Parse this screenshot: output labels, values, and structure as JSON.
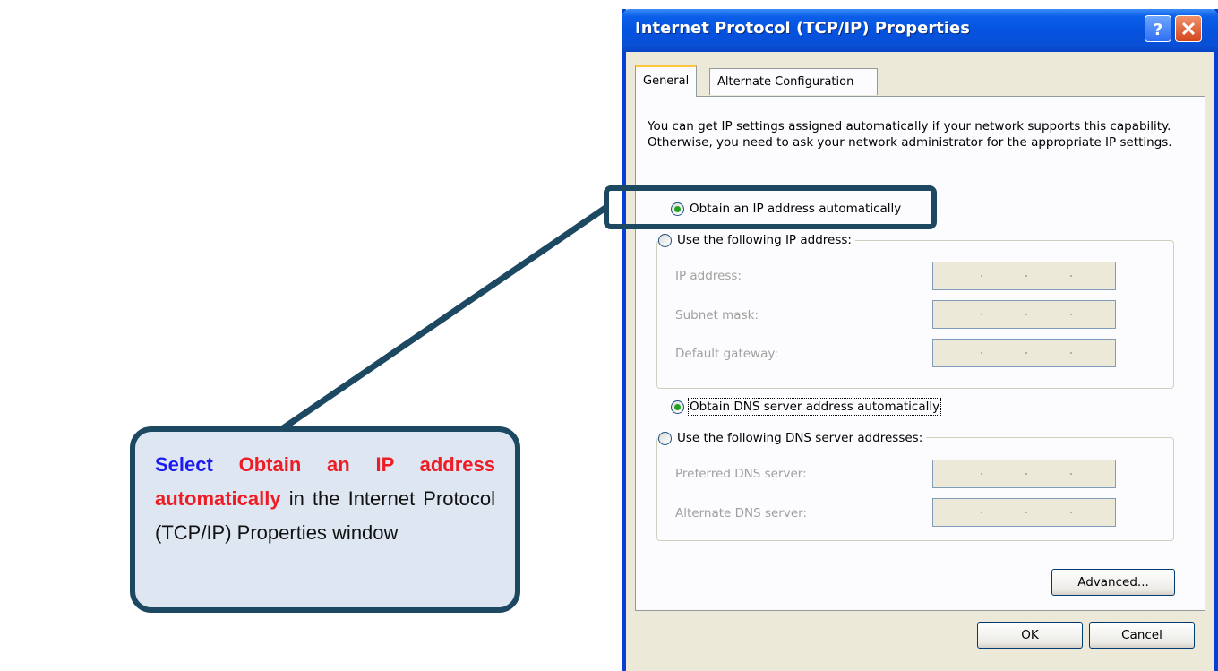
{
  "window": {
    "title": "Internet Protocol (TCP/IP) Properties",
    "tabs": [
      {
        "label": "General",
        "active": true
      },
      {
        "label": "Alternate Configuration",
        "active": false
      }
    ],
    "description": "You can get IP settings assigned automatically if your network supports this capability. Otherwise, you need to ask your network administrator for the appropriate IP settings.",
    "ip_section": {
      "auto_option": "Obtain an IP address automatically",
      "manual_option": "Use the following IP address:",
      "selected": "auto",
      "fields": [
        {
          "label": "IP address:",
          "value": ""
        },
        {
          "label": "Subnet mask:",
          "value": ""
        },
        {
          "label": "Default gateway:",
          "value": ""
        }
      ]
    },
    "dns_section": {
      "auto_option": "Obtain DNS server address automatically",
      "manual_option": "Use the following DNS server addresses:",
      "selected": "auto",
      "fields": [
        {
          "label": "Preferred DNS server:",
          "value": ""
        },
        {
          "label": "Alternate DNS server:",
          "value": ""
        }
      ]
    },
    "buttons": {
      "advanced": "Advanced...",
      "ok": "OK",
      "cancel": "Cancel"
    }
  },
  "callout": {
    "word_select": "Select",
    "word_option": "Obtain an IP address automatically",
    "word_rest": "in the Internet Protocol (TCP/IP) Properties window"
  },
  "colors": {
    "callout_border": "#1c4862",
    "callout_fill": "#dde6f1",
    "highlight_blue": "#1b1bf0",
    "highlight_red": "#ee1c24",
    "titlebar_blue": "#0553e0"
  },
  "icons": {
    "help": "help-icon",
    "close": "close-icon"
  }
}
